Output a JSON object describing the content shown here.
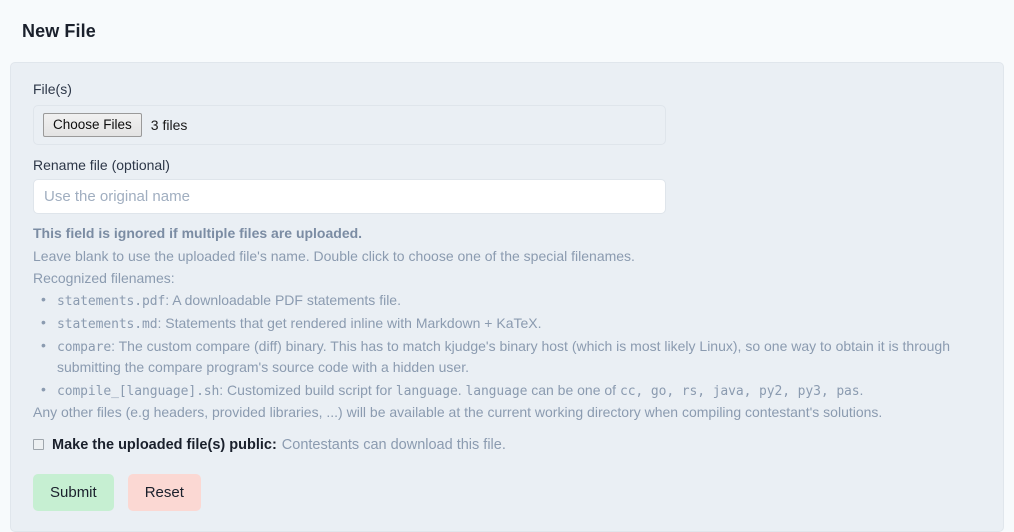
{
  "page": {
    "title": "New File",
    "background_color": "#f7fafc",
    "card_background_color": "#eaeff4"
  },
  "form": {
    "file_field": {
      "label": "File(s)",
      "choose_button_label": "Choose Files",
      "selected_text": "3 files"
    },
    "rename_field": {
      "label": "Rename file (optional)",
      "placeholder": "Use the original name",
      "value": ""
    },
    "help": {
      "warning": "This field is ignored if multiple files are uploaded.",
      "leave_blank": "Leave blank to use the uploaded file's name. Double click to choose one of the special filenames.",
      "recognized_heading": "Recognized filenames:",
      "items": [
        {
          "code": "statements.pdf",
          "text": ": A downloadable PDF statements file."
        },
        {
          "code": "statements.md",
          "text": ": Statements that get rendered inline with Markdown + KaTeX."
        },
        {
          "code": "compare",
          "text": ": The custom compare (diff) binary. This has to match kjudge's binary host (which is most likely Linux), so one way to obtain it is through submitting the compare program's source code with a hidden user."
        },
        {
          "code": "compile_[language].sh",
          "text": ": Customized build script for ",
          "code2": "language",
          "text2": ". ",
          "code3": "language",
          "text3": " can be one of ",
          "languages": "cc, go, rs, java, py2, py3, pas",
          "text4": "."
        }
      ],
      "footer": "Any other files (e.g headers, provided libraries, ...) will be available at the current working directory when compiling contestant's solutions."
    },
    "public_checkbox": {
      "checked": false,
      "label": "Make the uploaded file(s) public:",
      "note": "Contestants can download this file."
    },
    "buttons": {
      "submit_label": "Submit",
      "submit_color": "#c6efd2",
      "reset_label": "Reset",
      "reset_color": "#fbd8d3"
    }
  }
}
